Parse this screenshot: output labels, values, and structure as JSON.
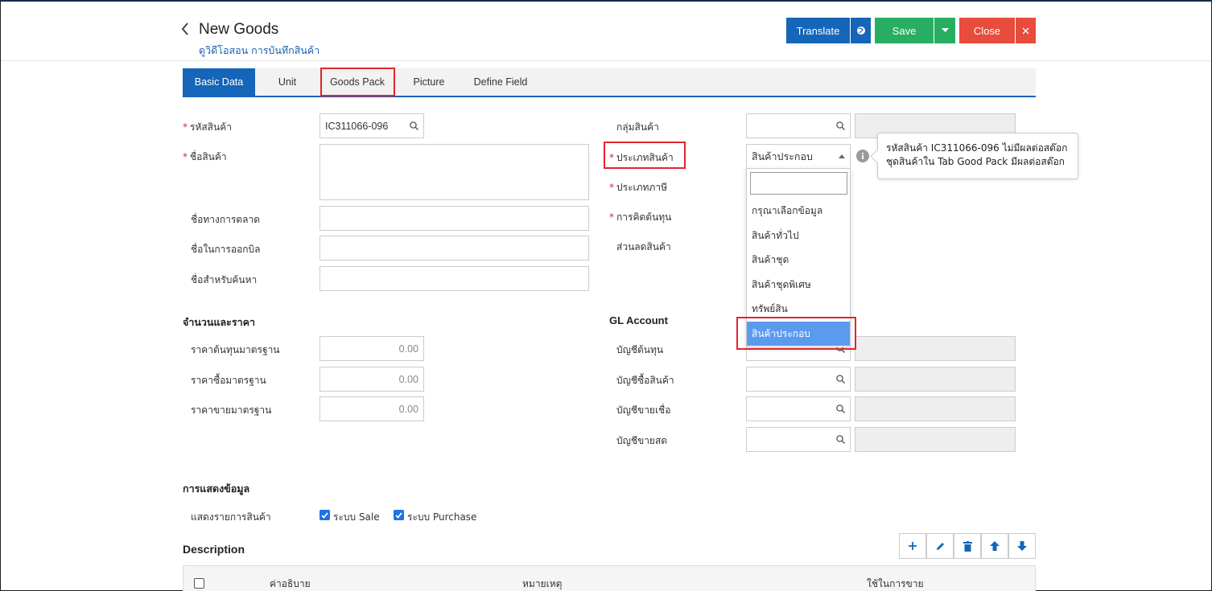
{
  "header": {
    "back_icon": "chevron-left-icon",
    "title": "New Goods",
    "subtitle": "ดูวิดีโอสอน การบันทึกสินค้า",
    "translate_label": "Translate",
    "save_label": "Save",
    "close_label": "Close"
  },
  "tabs": [
    {
      "label": "Basic Data",
      "active": true
    },
    {
      "label": "Unit"
    },
    {
      "label": "Goods Pack",
      "highlighted": true
    },
    {
      "label": "Picture"
    },
    {
      "label": "Define Field"
    }
  ],
  "left_form": {
    "code_label": "รหัสสินค้า",
    "code_value": "IC311066-096",
    "name_label": "ชื่อสินค้า",
    "marketing_name_label": "ชื่อทางการตลาด",
    "billing_name_label": "ชื่อในการออกบิล",
    "search_name_label": "ชื่อสำหรับค้นหา"
  },
  "price_section": {
    "title": "จำนวนและราคา",
    "std_cost_label": "ราคาต้นทุนมาตรฐาน",
    "std_cost_value": "0.00",
    "std_buy_label": "ราคาซื้อมาตรฐาน",
    "std_buy_value": "0.00",
    "std_sell_label": "ราคาขายมาตรฐาน",
    "std_sell_value": "0.00"
  },
  "right_form": {
    "group_label": "กลุ่มสินค้า",
    "type_label": "ประเภทสินค้า",
    "type_value": "สินค้าประกอบ",
    "tax_type_label": "ประเภทภาษี",
    "costing_label": "การคิดต้นทุน",
    "discount_label": "ส่วนลดสินค้า"
  },
  "dropdown": {
    "options": [
      "กรุณาเลือกข้อมูล",
      "สินค้าทั่วไป",
      "สินค้าชุด",
      "สินค้าชุดพิเศษ",
      "ทรัพย์สิน",
      "สินค้าประกอบ"
    ],
    "selected_index": 5
  },
  "tooltip": {
    "line1": "รหัสสินค้า IC311066-096 ไม่มีผลต่อสต๊อก",
    "line2": "ชุดสินค้าใน Tab Good Pack มีผลต่อสต๊อก"
  },
  "gl_section": {
    "title": "GL Account",
    "cost_account_label": "บัญชีต้นทุน",
    "purchase_account_label": "บัญชีซื้อสินค้า",
    "credit_sale_account_label": "บัญชีขายเชื่อ",
    "cash_sale_account_label": "บัญชีขายสด"
  },
  "display_section": {
    "title": "การแสดงข้อมูล",
    "show_items_label": "แสดงรายการสินค้า",
    "sale_label": "ระบบ Sale",
    "sale_checked": true,
    "purchase_label": "ระบบ Purchase",
    "purchase_checked": true
  },
  "description": {
    "title": "Description",
    "columns": [
      "ค่าอธิบาย",
      "หมายเหตุ",
      "ใช้ในการขาย"
    ]
  },
  "colors": {
    "primary": "#1565b8",
    "success": "#27ae60",
    "danger": "#e74c3c",
    "highlight": "#e0252e",
    "selected": "#5b9bef"
  }
}
